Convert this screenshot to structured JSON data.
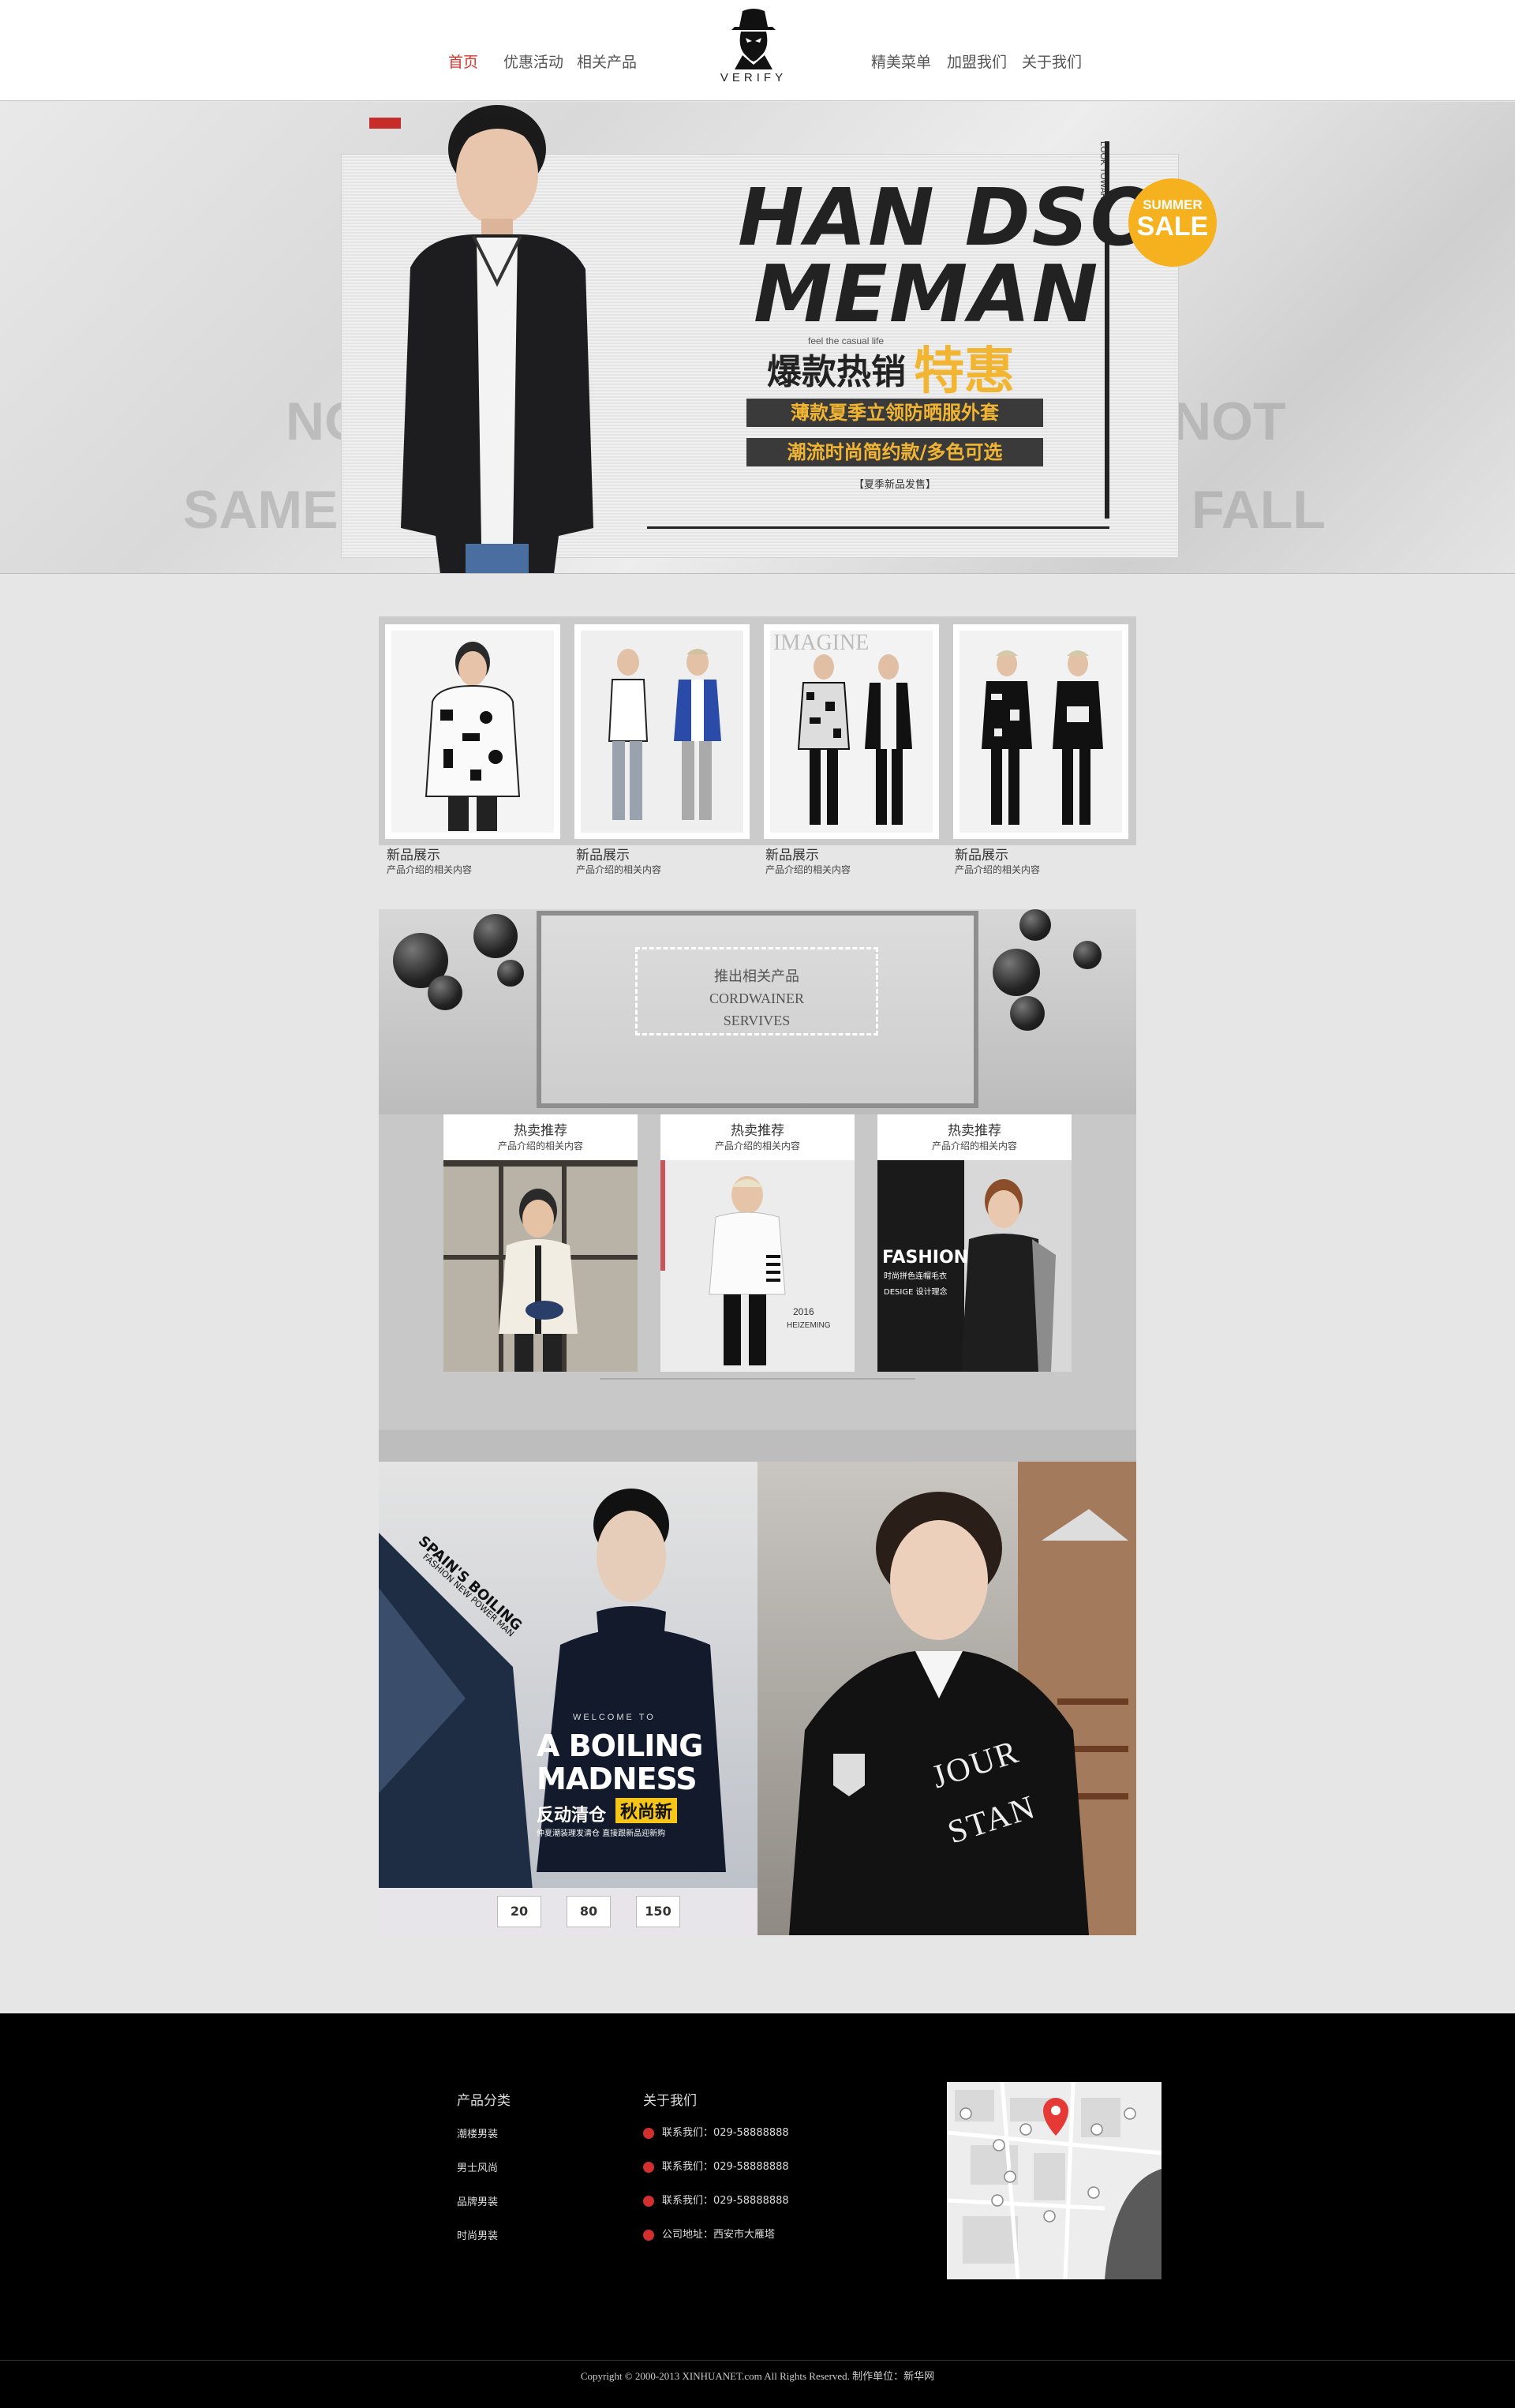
{
  "nav": {
    "left": [
      "首页",
      "优惠活动",
      "相关产品"
    ],
    "right": [
      "精美菜单",
      "加盟我们",
      "关于我们"
    ],
    "active": "首页"
  },
  "logo": {
    "brand": "VERIFY",
    "icon": "hat-man-icon"
  },
  "hero": {
    "headline_1": "HAN DSO",
    "headline_2": "MEMAN",
    "side_text": "LOOK TOWARDS",
    "small_note": "feel the casual life",
    "sub_1": "爆款热销",
    "sub_2": "特惠",
    "bar_1": "薄款夏季立领防晒服外套",
    "bar_2": "潮流时尚简约款/多色可选",
    "tagline": "【夏季新品发售】",
    "sale_1": "SUMMER",
    "sale_2": "SALE",
    "ghost_left_1": "NOT",
    "ghost_left_2": "SAME FA",
    "ghost_right_1": "NOT",
    "ghost_right_2": "FALL"
  },
  "new_products": [
    {
      "title": "新品展示",
      "desc": "产品介绍的相关内容"
    },
    {
      "title": "新品展示",
      "desc": "产品介绍的相关内容"
    },
    {
      "title": "新品展示",
      "desc": "产品介绍的相关内容"
    },
    {
      "title": "新品展示",
      "desc": "产品介绍的相关内容"
    }
  ],
  "hot": {
    "dash_1": "推出相关产品",
    "dash_2": "CORDWAINER",
    "dash_3": "SERVIVES",
    "cards": [
      {
        "title": "热卖推荐",
        "desc": "产品介绍的相关内容"
      },
      {
        "title": "热卖推荐",
        "desc": "产品介绍的相关内容"
      },
      {
        "title": "热卖推荐",
        "desc": "产品介绍的相关内容"
      }
    ],
    "card2_year": "2016",
    "card2_brand": "HEIZEMING",
    "card3_big": "FASHION",
    "card3_sub": "时尚拼色连帽毛衣",
    "card3_design": "DESIGE 设计理念"
  },
  "banner_left": {
    "diag_1": "SPAIN'S BOILING",
    "diag_2": "FASHION NEW POWER MAN",
    "welcome": "WELCOME TO",
    "big_1": "A BOILING",
    "big_2": "MADNESS",
    "cn_1": "反动清仓",
    "cn_2": "秋尚新",
    "small": "仲夏潮装理发清仓 直接跟新品迎新购",
    "coupons": [
      "20",
      "80",
      "150"
    ]
  },
  "banner_right": {
    "chest_1": "JOUR",
    "chest_2": "STAN"
  },
  "footer": {
    "col1_title": "产品分类",
    "col1_items": [
      "潮楼男装",
      "男士风尚",
      "品牌男装",
      "时尚男装"
    ],
    "col2_title": "关于我们",
    "col2_items": [
      "联系我们：029-58888888",
      "联系我们：029-58888888",
      "联系我们：029-58888888",
      "公司地址：西安市大雁塔"
    ],
    "copyright": "Copyright © 2000-2013 XINHUANET.com All Rights Reserved.     制作单位：新华网"
  },
  "colors": {
    "accent": "#d9332a",
    "sale": "#f5b21e",
    "bar_text": "#f2b531",
    "footer_bg": "#000000"
  }
}
